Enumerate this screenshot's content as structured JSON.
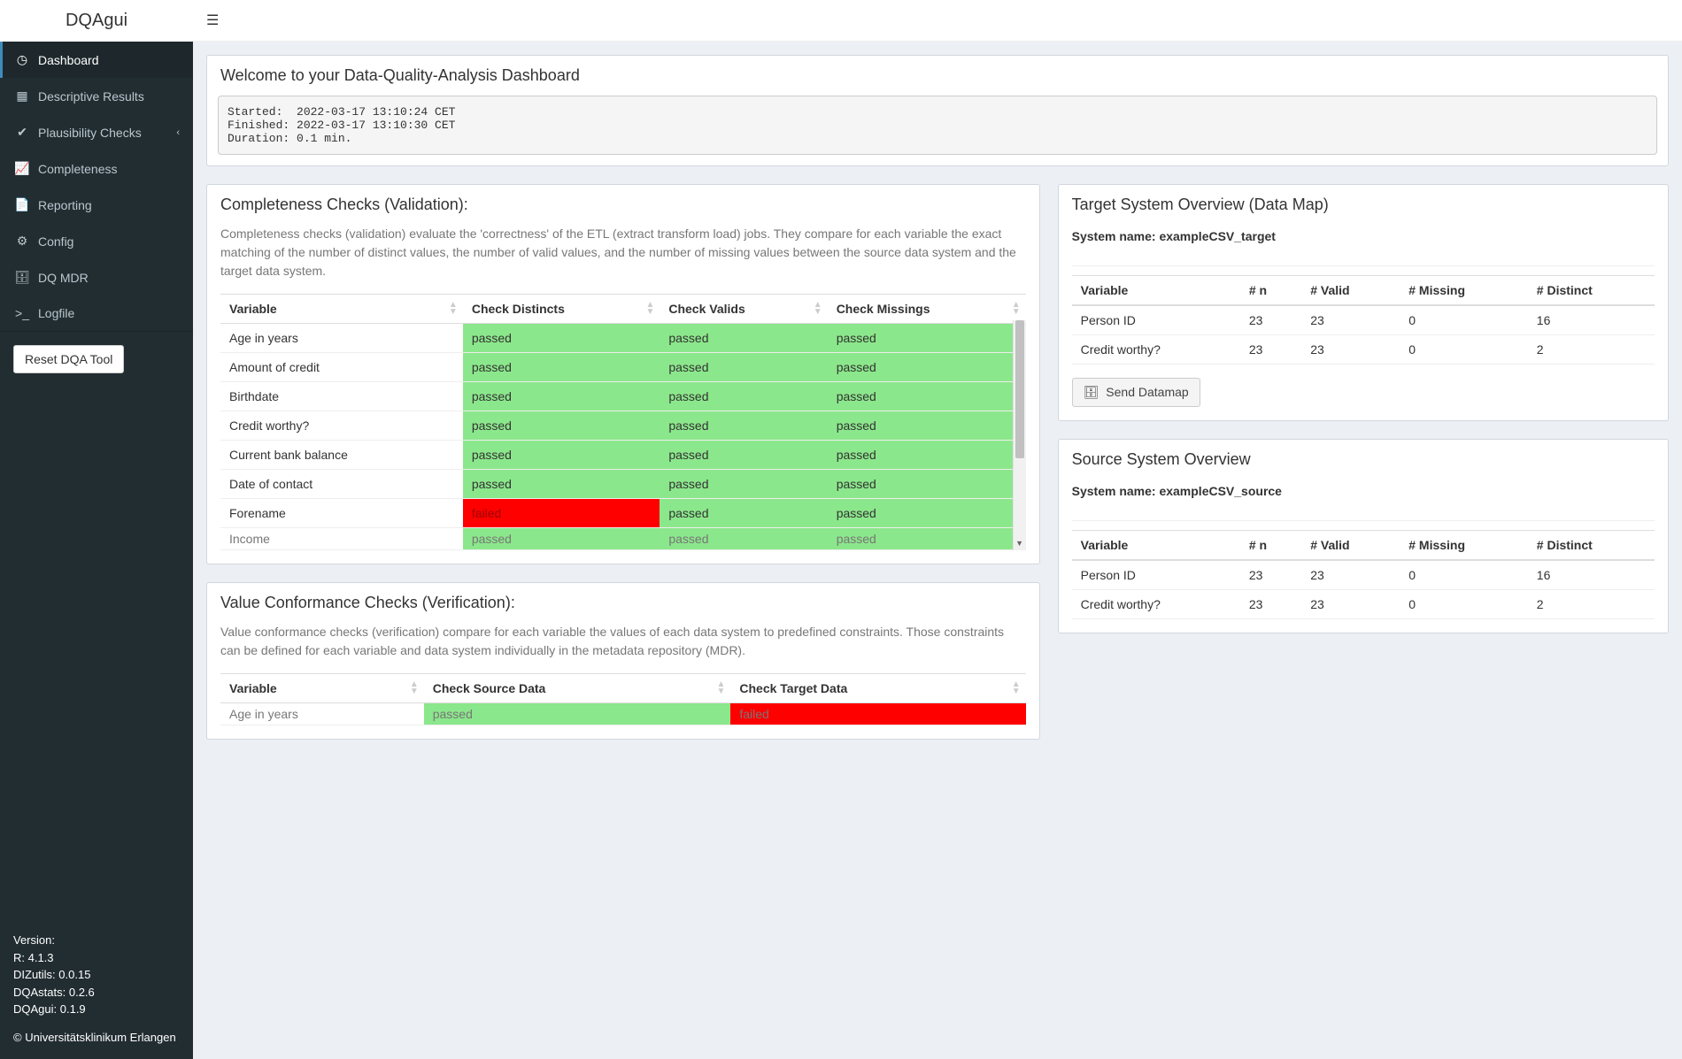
{
  "brand": "DQAgui",
  "sidebar": {
    "items": [
      {
        "icon": "◷",
        "label": "Dashboard",
        "active": true
      },
      {
        "icon": "▦",
        "label": "Descriptive Results"
      },
      {
        "icon": "✔",
        "label": "Plausibility Checks",
        "chev": "‹"
      },
      {
        "icon": "📈",
        "label": "Completeness"
      },
      {
        "icon": "📄",
        "label": "Reporting"
      },
      {
        "icon": "⚙",
        "label": "Config"
      },
      {
        "icon": "🗄",
        "label": "DQ MDR"
      },
      {
        "icon": ">_",
        "label": "Logfile"
      }
    ],
    "reset_label": "Reset DQA Tool",
    "footer": {
      "version_label": "Version:",
      "r": "R: 4.1.3",
      "dizutils": "DIZutils: 0.0.15",
      "dqastats": "DQAstats: 0.2.6",
      "dqagui": "DQAgui: 0.1.9",
      "copyright": "© Universitätsklinikum Erlangen"
    }
  },
  "welcome": {
    "title": "Welcome to your Data-Quality-Analysis Dashboard",
    "log": "Started:  2022-03-17 13:10:24 CET\nFinished: 2022-03-17 13:10:30 CET\nDuration: 0.1 min."
  },
  "completeness": {
    "title": "Completeness Checks (Validation):",
    "desc": "Completeness checks (validation) evaluate the 'correctness' of the ETL (extract transform load) jobs. They compare for each variable the exact matching of the number of distinct values, the number of valid values, and the number of missing values between the source data system and the target data system.",
    "cols": [
      "Variable",
      "Check Distincts",
      "Check Valids",
      "Check Missings"
    ],
    "rows": [
      {
        "v": "Age in years",
        "d": "passed",
        "va": "passed",
        "m": "passed"
      },
      {
        "v": "Amount of credit",
        "d": "passed",
        "va": "passed",
        "m": "passed"
      },
      {
        "v": "Birthdate",
        "d": "passed",
        "va": "passed",
        "m": "passed"
      },
      {
        "v": "Credit worthy?",
        "d": "passed",
        "va": "passed",
        "m": "passed"
      },
      {
        "v": "Current bank balance",
        "d": "passed",
        "va": "passed",
        "m": "passed"
      },
      {
        "v": "Date of contact",
        "d": "passed",
        "va": "passed",
        "m": "passed"
      },
      {
        "v": "Forename",
        "d": "failed",
        "va": "passed",
        "m": "passed"
      }
    ],
    "cutrow": {
      "v": "Income",
      "d": "passed",
      "va": "passed",
      "m": "passed"
    }
  },
  "conformance": {
    "title": "Value Conformance Checks (Verification):",
    "desc": "Value conformance checks (verification) compare for each variable the values of each data system to predefined constraints. Those constraints can be defined for each variable and data system individually in the metadata repository (MDR).",
    "cols": [
      "Variable",
      "Check Source Data",
      "Check Target Data"
    ],
    "rows": [
      {
        "v": "Age in years",
        "s": "passed",
        "t": "failed"
      }
    ]
  },
  "target": {
    "title": "Target System Overview (Data Map)",
    "sysname_label": "System name:",
    "sysname": "exampleCSV_target",
    "cols": [
      "Variable",
      "# n",
      "# Valid",
      "# Missing",
      "# Distinct"
    ],
    "rows": [
      {
        "v": "Person ID",
        "n": "23",
        "valid": "23",
        "miss": "0",
        "dist": "16"
      },
      {
        "v": "Credit worthy?",
        "n": "23",
        "valid": "23",
        "miss": "0",
        "dist": "2"
      }
    ],
    "send_label": "Send Datamap"
  },
  "source": {
    "title": "Source System Overview",
    "sysname_label": "System name:",
    "sysname": "exampleCSV_source",
    "cols": [
      "Variable",
      "# n",
      "# Valid",
      "# Missing",
      "# Distinct"
    ],
    "rows": [
      {
        "v": "Person ID",
        "n": "23",
        "valid": "23",
        "miss": "0",
        "dist": "16"
      },
      {
        "v": "Credit worthy?",
        "n": "23",
        "valid": "23",
        "miss": "0",
        "dist": "2"
      }
    ]
  }
}
